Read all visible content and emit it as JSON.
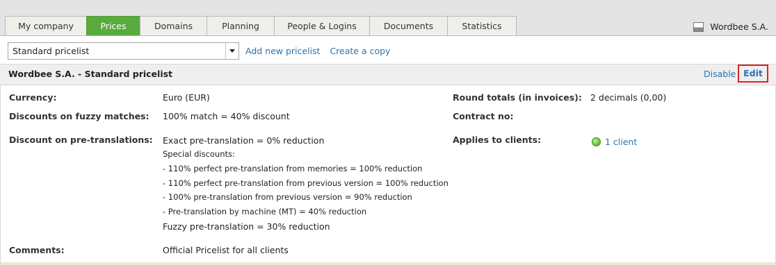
{
  "tabs": [
    {
      "label": "My company",
      "active": false
    },
    {
      "label": "Prices",
      "active": true
    },
    {
      "label": "Domains",
      "active": false
    },
    {
      "label": "Planning",
      "active": false
    },
    {
      "label": "People & Logins",
      "active": false
    },
    {
      "label": "Documents",
      "active": false
    },
    {
      "label": "Statistics",
      "active": false
    }
  ],
  "company_name": "Wordbee S.A.",
  "toolbar": {
    "pricelist_selected": "Standard pricelist",
    "add_new_label": "Add new pricelist",
    "create_copy_label": "Create a copy"
  },
  "header": {
    "title": "Wordbee S.A. - Standard pricelist",
    "disable_label": "Disable",
    "edit_label": "Edit"
  },
  "details": {
    "currency_label": "Currency:",
    "currency_value": "Euro (EUR)",
    "fuzzy_label": "Discounts on fuzzy matches:",
    "fuzzy_value": "100% match = 40% discount",
    "pretrans_label": "Discount on pre-translations:",
    "pretrans_lines": [
      "Exact pre-translation = 0% reduction",
      "Special discounts:",
      "- 110% perfect pre-translation from memories = 100% reduction",
      "- 110% perfect pre-translation from previous version = 100% reduction",
      "- 100% pre-translation from previous version = 90% reduction",
      "- Pre-translation by machine (MT) = 40% reduction",
      "Fuzzy pre-translation = 30% reduction"
    ],
    "comments_label": "Comments:",
    "comments_value": "Official Pricelist for all clients",
    "round_label": "Round totals (in invoices):",
    "round_value": "2 decimals (0,00)",
    "contract_label": "Contract no:",
    "applies_label": "Applies to clients:",
    "applies_value": "1 client"
  },
  "colors": {
    "active_tab": "#5aab3e",
    "link": "#2a72ad",
    "highlight_border": "#e02020"
  }
}
